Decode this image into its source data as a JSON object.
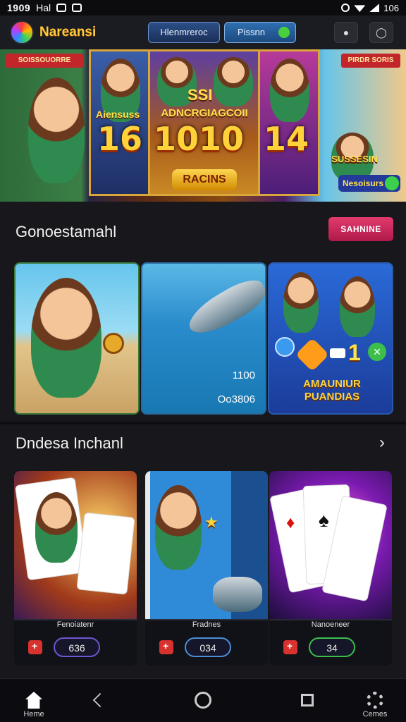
{
  "status_bar": {
    "time": "1909",
    "carrier": "Hal",
    "battery": "106"
  },
  "header": {
    "app_name": "Nareansi",
    "button_1": "Hlenmreroc",
    "button_2": "Pissnn"
  },
  "banner": {
    "left_tag": "SOISSOUORRE",
    "right_tag": "PIRDR SORIS",
    "center_label": "ADNCRGIAGCOII",
    "left_label": "Aiensuss",
    "numbers": [
      "16",
      "1010",
      "14"
    ],
    "center_top": "SSI",
    "racing_label": "RACINS",
    "right_label": "SUSSESIN",
    "right_bottom_label": "Nesoisurs"
  },
  "section_1": {
    "title": "Gonoestamahl",
    "button_label": "SAHNINE",
    "cards": [
      {
        "label": ""
      },
      {
        "number_1": "1100",
        "number_2": "Oo3806"
      },
      {
        "label": "AMAUNIUR PUANDIAS",
        "number": "1"
      }
    ]
  },
  "section_2": {
    "title": "Dndesa Inchanl",
    "games": [
      {
        "name": "Fenoiatenr",
        "value": "636"
      },
      {
        "name": "Fradnes",
        "value": "034"
      },
      {
        "name": "Nanoeneer",
        "value": "34"
      }
    ]
  },
  "nav": {
    "items": [
      {
        "label": "Heme",
        "icon": "home-icon"
      },
      {
        "label": "",
        "icon": "back-icon"
      },
      {
        "label": "",
        "icon": "circle-icon"
      },
      {
        "label": "",
        "icon": "square-icon"
      },
      {
        "label": "Cemes",
        "icon": "gear-icon"
      }
    ]
  },
  "colors": {
    "accent": "#e13a6d",
    "gold": "#ffd23a",
    "background": "#17171c"
  }
}
